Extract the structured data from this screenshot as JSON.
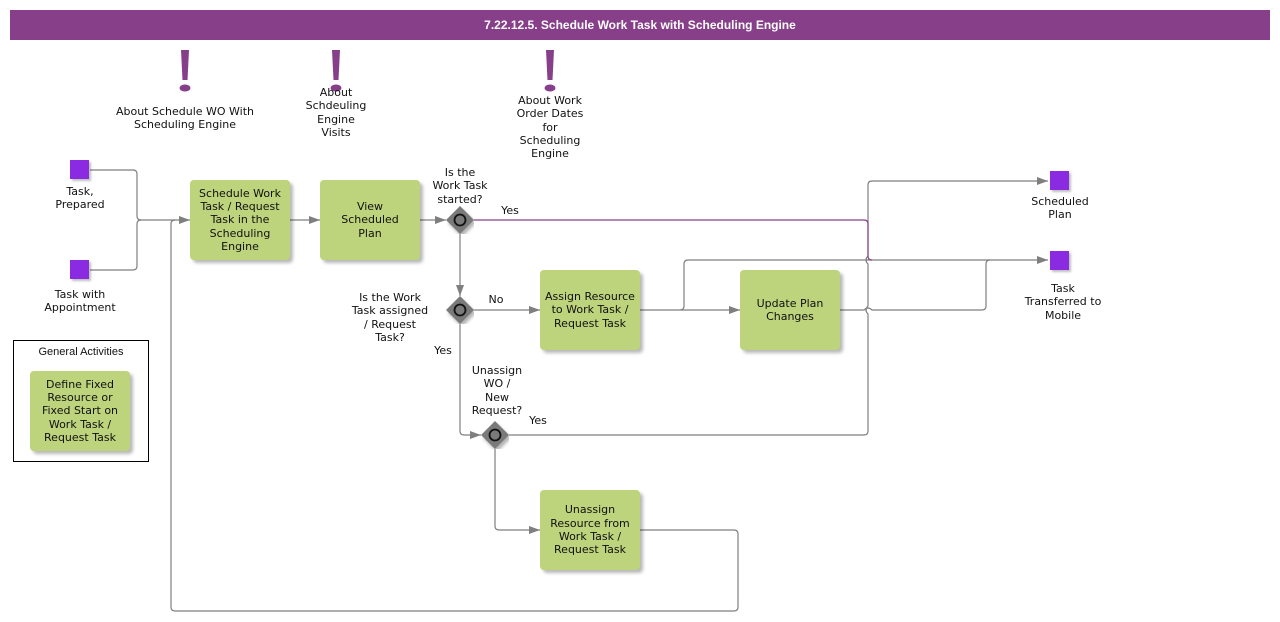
{
  "header": {
    "title": "7.22.12.5. Schedule Work Task with Scheduling Engine"
  },
  "colors": {
    "title_bar": "#873f8a",
    "task_fill": "#bdd37c",
    "event_fill": "#8a2be2",
    "gateway_fill": "#7a7a7a",
    "connector": "#7f7f7f",
    "yes_path": "#873f8a",
    "annotation_icon": "#873f8a"
  },
  "annotations": [
    {
      "icon": "exclamation-icon",
      "label": "About Schedule WO With\nScheduling Engine"
    },
    {
      "icon": "exclamation-icon",
      "label": "About\nSchdeuling\nEngine\nVisits"
    },
    {
      "icon": "exclamation-icon",
      "label": "About Work\nOrder Dates\nfor\nScheduling\nEngine"
    }
  ],
  "start_events": [
    {
      "label": "Task,\nPrepared"
    },
    {
      "label": "Task with\nAppointment"
    }
  ],
  "end_events": [
    {
      "label": "Scheduled\nPlan"
    },
    {
      "label": "Task\nTransferred to\nMobile"
    }
  ],
  "tasks": [
    {
      "label": "Schedule Work\nTask / Request\nTask in the\nScheduling\nEngine"
    },
    {
      "label": "View\nScheduled\nPlan"
    },
    {
      "label": "Assign Resource\nto Work Task /\nRequest Task"
    },
    {
      "label": "Update Plan\nChanges"
    },
    {
      "label": "Unassign\nResource from\nWork Task /\nRequest Task"
    }
  ],
  "gateways": [
    {
      "label": "Is the\nWork Task\nstarted?",
      "icon": "circle-icon"
    },
    {
      "label": "Is the Work\nTask assigned\n/ Request\nTask?",
      "icon": "circle-icon"
    },
    {
      "label": "Unassign\nWO /\nNew\nRequest?",
      "icon": "circle-icon"
    }
  ],
  "flow_labels": {
    "yes1": "Yes",
    "no": "No",
    "yes2": "Yes",
    "yes3": "Yes"
  },
  "legend": {
    "title": "General Activities",
    "items": [
      {
        "label": "Define Fixed\nResource or\nFixed Start on\nWork Task  /\nRequest Task"
      }
    ]
  }
}
